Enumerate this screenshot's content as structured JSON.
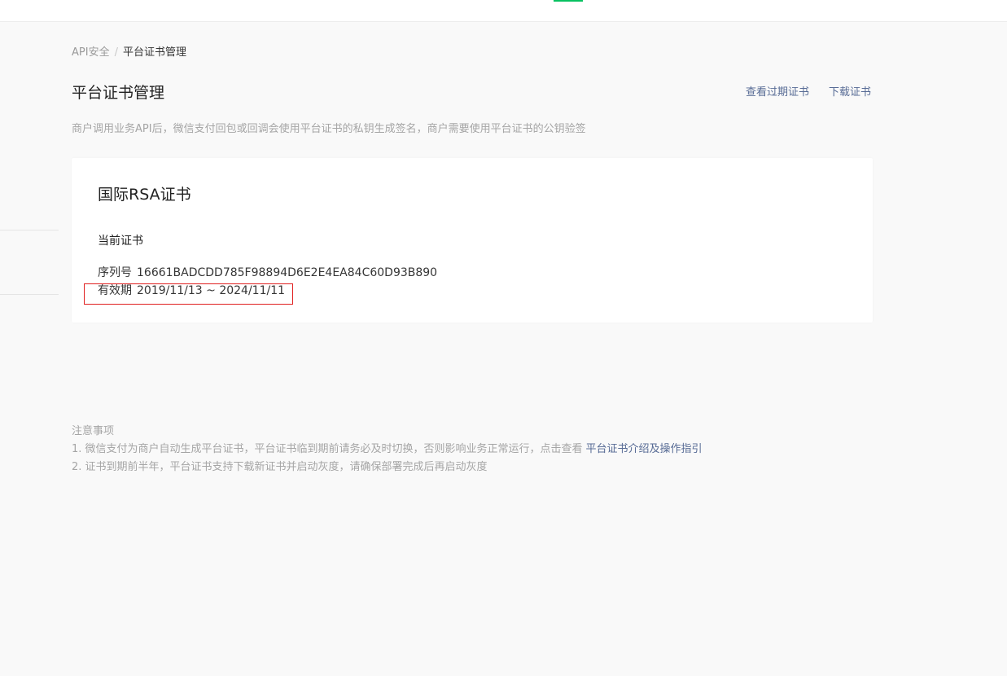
{
  "breadcrumb": {
    "parent": "API安全",
    "separator": "/",
    "current": "平台证书管理"
  },
  "header": {
    "title": "平台证书管理",
    "actions": {
      "view_expired": "查看过期证书",
      "download": "下载证书"
    },
    "description": "商户调用业务API后，微信支付回包或回调会使用平台证书的私钥生成签名，商户需要使用平台证书的公钥验签"
  },
  "card": {
    "title": "国际RSA证书",
    "subtitle": "当前证书",
    "serial_label": "序列号",
    "serial_value": "16661BADCDD785F98894D6E2E4EA84C60D93B890",
    "validity_label": "有效期",
    "validity_value": "2019/11/13 ~ 2024/11/11"
  },
  "notes": {
    "title": "注意事项",
    "item1_text": "1. 微信支付为商户自动生成平台证书，平台证书临到期前请务必及时切换，否则影响业务正常运行，点击查看",
    "item1_link": "平台证书介绍及操作指引",
    "item2_text": "2. 证书到期前半年，平台证书支持下载新证书并启动灰度，请确保部署完成后再启动灰度"
  },
  "colors": {
    "accent_green": "#07c160",
    "link_blue": "#576b95",
    "highlight_red": "#e02020"
  }
}
